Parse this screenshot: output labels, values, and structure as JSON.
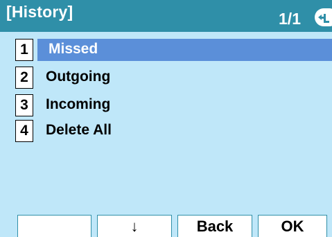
{
  "header": {
    "title": "[History]",
    "page_indicator": "1/1",
    "nav_icon": "scroll-arrow-icon"
  },
  "menu": {
    "items": [
      {
        "number": "1",
        "label": "Missed",
        "selected": true
      },
      {
        "number": "2",
        "label": "Outgoing",
        "selected": false
      },
      {
        "number": "3",
        "label": "Incoming",
        "selected": false
      },
      {
        "number": "4",
        "label": "Delete All",
        "selected": false
      }
    ]
  },
  "softkeys": {
    "sk1": "",
    "sk2": "↓",
    "sk3": "Back",
    "sk4": "OK"
  },
  "colors": {
    "header": "#2f8fa8",
    "background": "#bfe7f9",
    "highlight": "#5b8fd9"
  }
}
